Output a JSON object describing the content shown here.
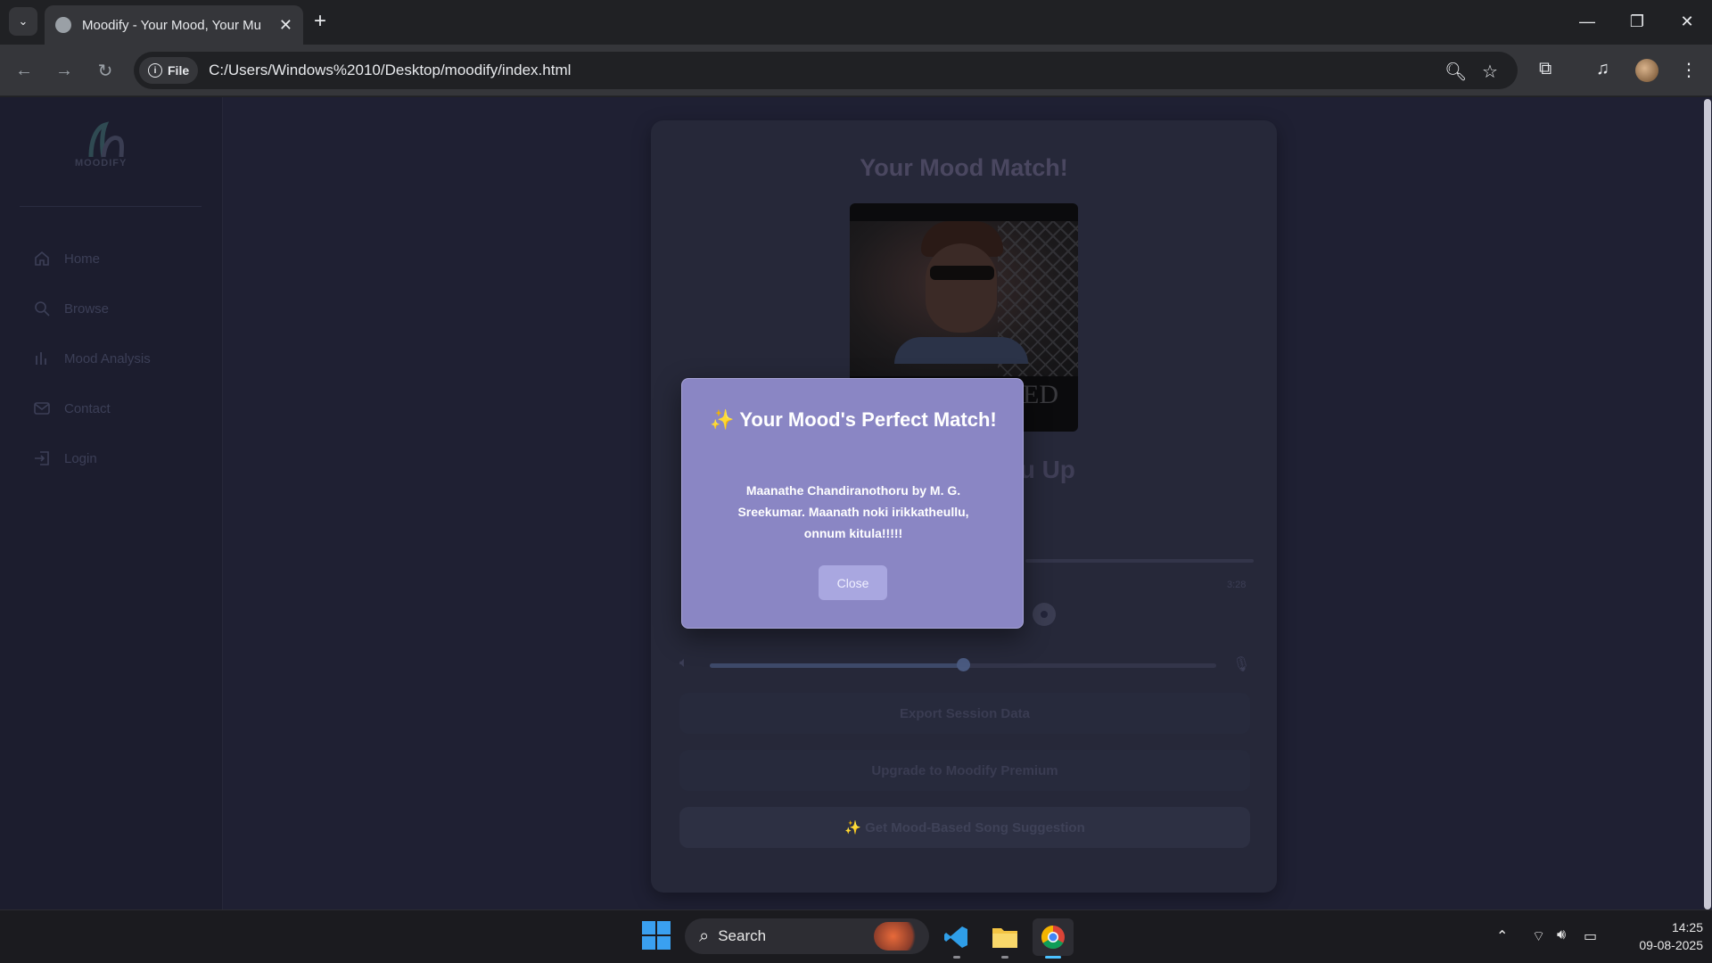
{
  "browser": {
    "tab_title": "Moodify - Your Mood, Your Mu",
    "site_chip": "File",
    "url": "C:/Users/Windows%2010/Desktop/moodify/index.html"
  },
  "sidebar": {
    "logo_text": "MOODIFY",
    "items": [
      {
        "label": "Home",
        "icon": "home-icon"
      },
      {
        "label": "Browse",
        "icon": "search-icon"
      },
      {
        "label": "Mood Analysis",
        "icon": "chart-icon"
      },
      {
        "label": "Contact",
        "icon": "mail-icon"
      },
      {
        "label": "Login",
        "icon": "login-icon"
      }
    ]
  },
  "card": {
    "title": "Your Mood Match!",
    "album_caption": "ED",
    "song_title_fragment": "You Up",
    "duration": "3:28",
    "volume_level": 0.5,
    "buttons": {
      "export": "Export Session Data",
      "upgrade": "Upgrade to Moodify Premium",
      "suggest": "✨ Get Mood-Based Song Suggestion"
    }
  },
  "modal": {
    "title": "✨ Your Mood's Perfect Match!",
    "message": "Maanathe Chandiranothoru by M. G. Sreekumar. Maanath noki irikkatheullu, onnum kitula!!!!!",
    "close_label": "Close"
  },
  "taskbar": {
    "search_label": "Search",
    "time": "14:25",
    "date": "09-08-2025"
  },
  "colors": {
    "page_bg": "#1f2033",
    "card_bg": "#262839",
    "modal_bg": "#8a86c4",
    "accent": "#4cc2ff"
  }
}
